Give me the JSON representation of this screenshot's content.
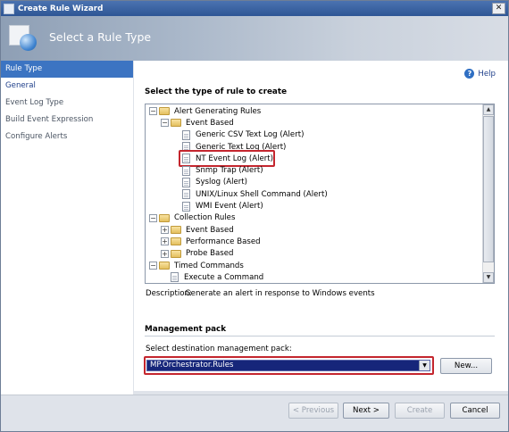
{
  "window": {
    "title": "Create Rule Wizard",
    "close_glyph": "✕"
  },
  "header": {
    "page_heading": "Select a Rule Type"
  },
  "nav": {
    "items": [
      {
        "label": "Rule Type"
      },
      {
        "label": "General"
      },
      {
        "label": "Event Log Type"
      },
      {
        "label": "Build Event Expression"
      },
      {
        "label": "Configure Alerts"
      }
    ]
  },
  "help": {
    "label": "Help",
    "glyph": "?"
  },
  "rule_section": {
    "title": "Select the type of rule to create"
  },
  "tree": {
    "rows": [
      {
        "label": "Alert Generating Rules",
        "expander": "−",
        "icon": "folder-icon",
        "level": 0
      },
      {
        "label": "Event Based",
        "expander": "−",
        "icon": "folder-icon",
        "level": 1
      },
      {
        "label": "Generic CSV Text Log (Alert)",
        "expander": "",
        "icon": "rule-document-icon",
        "level": 2
      },
      {
        "label": "Generic Text Log (Alert)",
        "expander": "",
        "icon": "rule-document-icon",
        "level": 2
      },
      {
        "label": "NT Event Log (Alert)",
        "expander": "",
        "icon": "rule-document-icon",
        "level": 2,
        "selected": true
      },
      {
        "label": "Snmp Trap (Alert)",
        "expander": "",
        "icon": "rule-document-icon",
        "level": 2
      },
      {
        "label": "Syslog (Alert)",
        "expander": "",
        "icon": "rule-document-icon",
        "level": 2
      },
      {
        "label": "UNIX/Linux Shell Command (Alert)",
        "expander": "",
        "icon": "rule-document-icon",
        "level": 2
      },
      {
        "label": "WMI Event (Alert)",
        "expander": "",
        "icon": "rule-document-icon",
        "level": 2
      },
      {
        "label": "Collection Rules",
        "expander": "−",
        "icon": "folder-icon",
        "level": 0
      },
      {
        "label": "Event Based",
        "expander": "+",
        "icon": "folder-icon",
        "level": 1
      },
      {
        "label": "Performance Based",
        "expander": "+",
        "icon": "folder-icon",
        "level": 1
      },
      {
        "label": "Probe Based",
        "expander": "+",
        "icon": "folder-icon",
        "level": 1
      },
      {
        "label": "Timed Commands",
        "expander": "−",
        "icon": "folder-icon",
        "level": 0
      },
      {
        "label": "Execute a Command",
        "expander": "",
        "icon": "rule-document-icon",
        "level": 1
      }
    ],
    "scroll_up_glyph": "▲",
    "scroll_down_glyph": "▼"
  },
  "description": {
    "label": "Description:",
    "text": "Generate an alert in response to Windows events"
  },
  "management_pack": {
    "title": "Management pack",
    "select_label": "Select destination management pack:",
    "selected_value": "MP.Orchestrator.Rules",
    "dropdown_glyph": "▼",
    "new_button": "New..."
  },
  "footer": {
    "previous": "< Previous",
    "next": "Next >",
    "create": "Create",
    "cancel": "Cancel"
  },
  "colors": {
    "nav_active": "#3c74c2",
    "highlight_red": "#c4262e",
    "select_fill": "#16267a"
  }
}
